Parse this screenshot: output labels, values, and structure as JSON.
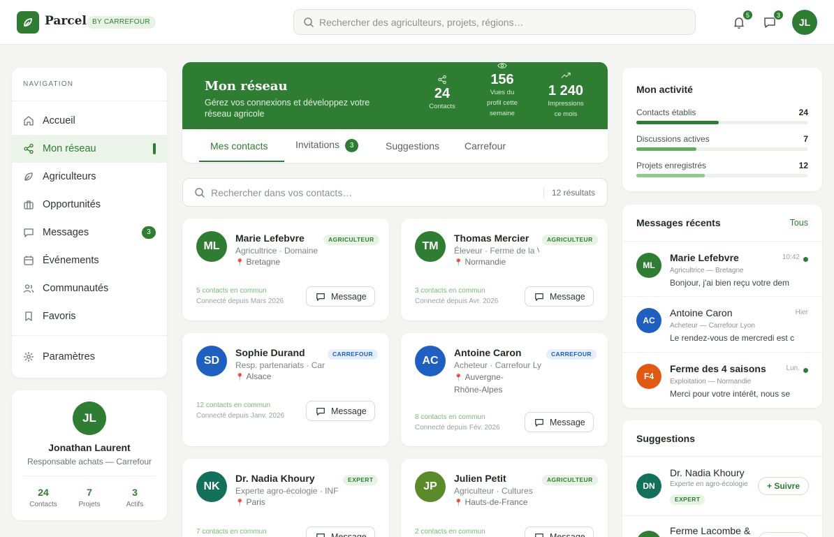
{
  "brand": {
    "name": "Parcel",
    "badge": "BY CARREFOUR"
  },
  "header": {
    "search_placeholder": "Rechercher des agriculteurs, projets, régions…",
    "notifications_count": "5",
    "messages_count": "3",
    "user_initials": "JL"
  },
  "nav": {
    "heading": "NAVIGATION",
    "items": [
      {
        "label": "Accueil",
        "icon": "home-icon"
      },
      {
        "label": "Mon réseau",
        "icon": "share-icon",
        "active": true
      },
      {
        "label": "Agriculteurs",
        "icon": "leaf-icon"
      },
      {
        "label": "Opportunités",
        "icon": "briefcase-icon"
      },
      {
        "label": "Messages",
        "icon": "chat-icon",
        "count": "3"
      },
      {
        "label": "Événements",
        "icon": "calendar-icon"
      },
      {
        "label": "Communautés",
        "icon": "users-icon"
      },
      {
        "label": "Favoris",
        "icon": "bookmark-icon"
      }
    ],
    "settings_label": "Paramètres"
  },
  "profile": {
    "initials": "JL",
    "name": "Jonathan Laurent",
    "role": "Responsable achats — Carrefour",
    "stats": [
      {
        "value": "24",
        "label": "Contacts"
      },
      {
        "value": "7",
        "label": "Projets"
      },
      {
        "value": "3",
        "label": "Actifs"
      }
    ]
  },
  "hero": {
    "title": "Mon réseau",
    "subtitle": "Gérez vos connexions et développez votre réseau agricole",
    "stats": [
      {
        "value": "24",
        "label": "Contacts"
      },
      {
        "value": "156",
        "label": "Vues du profil cette semaine"
      },
      {
        "value": "1 240",
        "label": "Impressions ce mois"
      }
    ]
  },
  "tabs": [
    {
      "label": "Mes contacts",
      "active": true
    },
    {
      "label": "Invitations",
      "count": "3"
    },
    {
      "label": "Suggestions"
    },
    {
      "label": "Carrefour"
    }
  ],
  "contacts_search": {
    "placeholder": "Rechercher dans vos contacts…",
    "results": "12 résultats"
  },
  "message_button_label": "Message",
  "contacts": [
    {
      "initials": "ML",
      "name": "Marie Lefebvre",
      "tag": "AGRICULTEUR",
      "subtitle": "Agricultrice · Domaine",
      "location": "Bretagne",
      "common": "5 contacts en commun",
      "since": "Connecté depuis Mars 2026",
      "color": "#2e7d32"
    },
    {
      "initials": "TM",
      "name": "Thomas Mercier",
      "tag": "AGRICULTEUR",
      "subtitle": "Éleveur · Ferme de la V",
      "location": "Normandie",
      "common": "3 contacts en commun",
      "since": "Connecté depuis Avr. 2026",
      "color": "#2e7d32"
    },
    {
      "initials": "SD",
      "name": "Sophie Durand",
      "tag": "CARREFOUR",
      "subtitle": "Resp. partenariats · Car",
      "location": "Alsace",
      "common": "12 contacts en commun",
      "since": "Connecté depuis Janv. 2026",
      "color": "#1e5fbf"
    },
    {
      "initials": "AC",
      "name": "Antoine Caron",
      "tag": "CARREFOUR",
      "subtitle": "Acheteur · Carrefour Ly",
      "location": "Auvergne-Rhône-Alpes",
      "common": "8 contacts en commun",
      "since": "Connecté depuis Fév. 2026",
      "color": "#1e5fbf"
    },
    {
      "initials": "NK",
      "name": "Dr. Nadia Khoury",
      "tag": "EXPERT",
      "subtitle": "Experte agro-écologie · INF",
      "location": "Paris",
      "common": "7 contacts en commun",
      "since": "",
      "color": "#13705a"
    },
    {
      "initials": "JP",
      "name": "Julien Petit",
      "tag": "AGRICULTEUR",
      "subtitle": "Agriculteur · Cultures",
      "location": "Hauts-de-France",
      "common": "2 contacts en commun",
      "since": "",
      "color": "#5a8a2a"
    }
  ],
  "activity": {
    "title": "Mon activité",
    "rows": [
      {
        "label": "Contacts établis",
        "value": "24",
        "fraction": 0.48,
        "color": "#2e7d32"
      },
      {
        "label": "Discussions actives",
        "value": "7",
        "fraction": 0.35,
        "color": "#5fae5a"
      },
      {
        "label": "Projets enregistrés",
        "value": "12",
        "fraction": 0.4,
        "color": "#8fcb89"
      }
    ]
  },
  "recent_messages": {
    "title": "Messages récents",
    "link": "Tous",
    "items": [
      {
        "initials": "ML",
        "name": "Marie Lefebvre",
        "time": "10:42",
        "meta": "Agricultrice — Bretagne",
        "text": "Bonjour, j'ai bien reçu votre dem",
        "unread": true,
        "color": "#2e7d32"
      },
      {
        "initials": "AC",
        "name": "Antoine Caron",
        "time": "Hier",
        "meta": "Acheteur — Carrefour Lyon",
        "text": "Le rendez-vous de mercredi est cor",
        "unread": false,
        "color": "#1e5fbf"
      },
      {
        "initials": "F4",
        "name": "Ferme des 4 saisons",
        "time": "Lun.",
        "meta": "Exploitation — Normandie",
        "text": "Merci pour votre intérêt, nous se",
        "unread": true,
        "color": "#e05a14"
      }
    ]
  },
  "suggestions": {
    "title": "Suggestions",
    "follow_label": "+ Suivre",
    "items": [
      {
        "initials": "DN",
        "name": "Dr. Nadia Khoury",
        "meta": "Experte en agro-écologie",
        "tag": "EXPERT",
        "color": "#13705a"
      },
      {
        "initials": "FL",
        "name": "Ferme Lacombe & Fils",
        "meta": "",
        "tag": "",
        "color": "#2e7d32"
      }
    ]
  }
}
